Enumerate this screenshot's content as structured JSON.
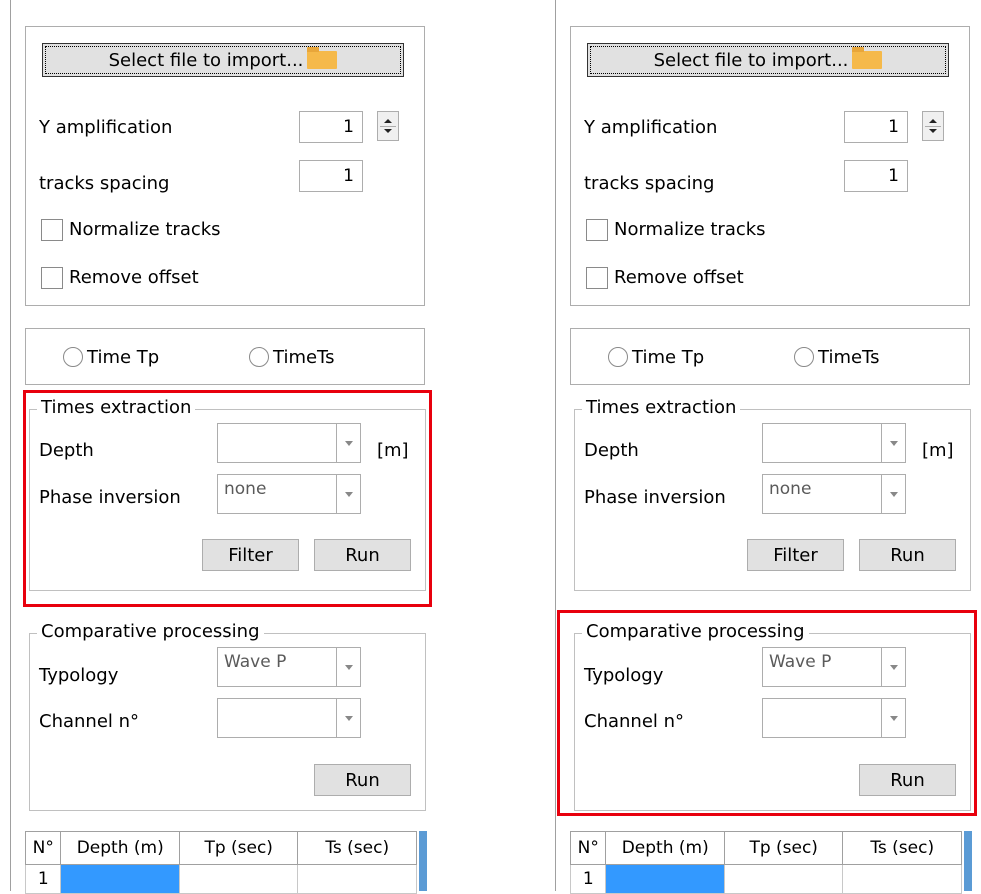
{
  "panels": [
    {
      "import_button": "Select file to import...",
      "y_amplification": {
        "label": "Y amplification",
        "value": "1"
      },
      "tracks_spacing": {
        "label": "tracks spacing",
        "value": "1"
      },
      "normalize_label": "Normalize tracks",
      "remove_offset_label": "Remove offset",
      "radio_tp": "Time Tp",
      "radio_ts": "TimeTs",
      "times_extraction": {
        "title": "Times extraction",
        "depth_label": "Depth",
        "depth_value": "",
        "unit": "[m]",
        "phase_label": "Phase inversion",
        "phase_value": "none",
        "filter_button": "Filter",
        "run_button": "Run"
      },
      "comparative": {
        "title": "Comparative processing",
        "typology_label": "Typology",
        "typology_value": "Wave P",
        "channel_label": "Channel n°",
        "channel_value": "",
        "run_button": "Run"
      },
      "table": {
        "headers": [
          "N°",
          "Depth (m)",
          "Tp (sec)",
          "Ts (sec)"
        ],
        "rows": [
          [
            "1",
            "",
            "",
            ""
          ]
        ]
      },
      "highlight": "times_extraction"
    },
    {
      "import_button": "Select file to import...",
      "y_amplification": {
        "label": "Y amplification",
        "value": "1"
      },
      "tracks_spacing": {
        "label": "tracks spacing",
        "value": "1"
      },
      "normalize_label": "Normalize tracks",
      "remove_offset_label": "Remove offset",
      "radio_tp": "Time Tp",
      "radio_ts": "TimeTs",
      "times_extraction": {
        "title": "Times extraction",
        "depth_label": "Depth",
        "depth_value": "",
        "unit": "[m]",
        "phase_label": "Phase inversion",
        "phase_value": "none",
        "filter_button": "Filter",
        "run_button": "Run"
      },
      "comparative": {
        "title": "Comparative processing",
        "typology_label": "Typology",
        "typology_value": "Wave P",
        "channel_label": "Channel n°",
        "channel_value": "",
        "run_button": "Run"
      },
      "table": {
        "headers": [
          "N°",
          "Depth (m)",
          "Tp (sec)",
          "Ts (sec)"
        ],
        "rows": [
          [
            "1",
            "",
            "",
            ""
          ]
        ]
      },
      "highlight": "comparative"
    }
  ],
  "colors": {
    "highlight": "#e8000d",
    "selected_cell": "#3399ff",
    "scrollbar": "#5b9bd5"
  }
}
